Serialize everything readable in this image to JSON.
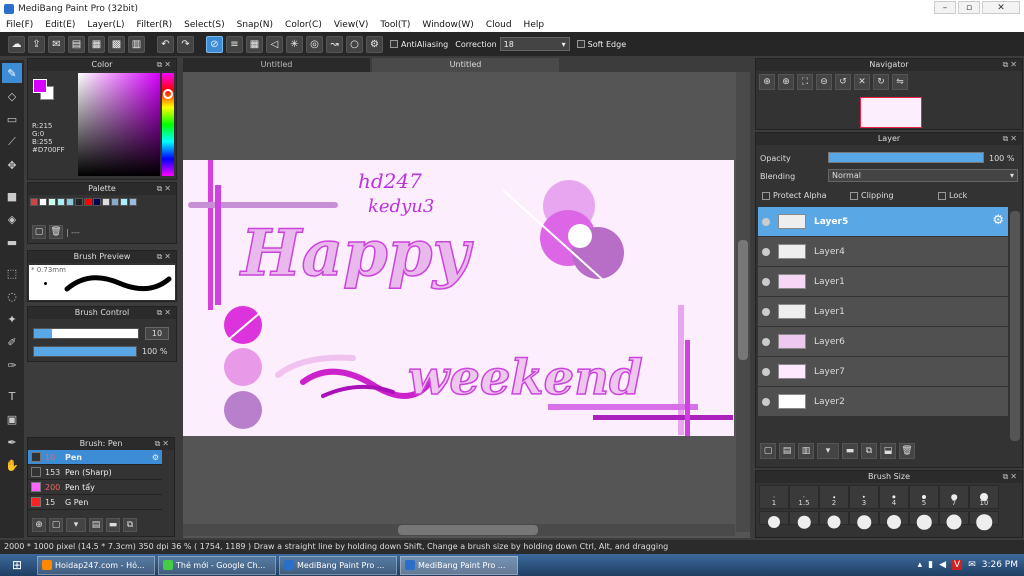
{
  "window": {
    "title": "MediBang Paint Pro (32bit)"
  },
  "menu": [
    "File(F)",
    "Edit(E)",
    "Layer(L)",
    "Filter(R)",
    "Select(S)",
    "Snap(N)",
    "Color(C)",
    "View(V)",
    "Tool(T)",
    "Window(W)",
    "Cloud",
    "Help"
  ],
  "toolbar": {
    "antialiasing_label": "AntiAliasing",
    "correction_label": "Correction",
    "correction_value": "18",
    "softedge_label": "Soft Edge"
  },
  "color": {
    "title": "Color",
    "fg": "#d700ff",
    "bg": "#ffffff",
    "r": "R:215",
    "g": "G:0",
    "b": "B:255",
    "hex": "#D700FF"
  },
  "palette": {
    "title": "Palette",
    "swatches": [
      "#c44",
      "#fff",
      "#cfe",
      "#aee",
      "#8cd",
      "#222",
      "#f00",
      "#005",
      "#ddd",
      "#8ac",
      "#aef",
      "#9bd"
    ],
    "more_label": "| ---"
  },
  "brush_preview": {
    "title": "Brush Preview",
    "size": "* 0.73mm"
  },
  "brush_control": {
    "title": "Brush Control",
    "size_value": "10",
    "size_fill": 0.95,
    "opacity_value": "100 %",
    "opacity_fill": 1.0
  },
  "brush_list": {
    "title": "Brush: Pen",
    "items": [
      {
        "size": "10",
        "name": "Pen",
        "color": "#333333"
      },
      {
        "size": "153",
        "name": "Pen (Sharp)",
        "color": "#333333"
      },
      {
        "size": "200",
        "name": "Pen tẩy",
        "color": "#ff66ff"
      },
      {
        "size": "15",
        "name": "G Pen",
        "color": "#ff2222"
      }
    ]
  },
  "tabs": [
    "Untitled",
    "Untitled"
  ],
  "navigator": {
    "title": "Navigator"
  },
  "layer_panel": {
    "title": "Layer",
    "opacity_label": "Opacity",
    "opacity_value": "100 %",
    "blending_label": "Blending",
    "blending_value": "Normal",
    "protect_alpha": "Protect Alpha",
    "clipping": "Clipping",
    "lock": "Lock",
    "layers": [
      "Layer5",
      "Layer4",
      "Layer1",
      "Layer1",
      "Layer6",
      "Layer7",
      "Layer2"
    ]
  },
  "brush_size": {
    "title": "Brush Size",
    "labels": [
      "1",
      "1.5",
      "2",
      "3",
      "4",
      "5",
      "7",
      "10"
    ]
  },
  "canvas_text": {
    "tag1": "hd247",
    "tag2": "kedyu3",
    "word1": "Happy",
    "word2": "weekend"
  },
  "status": "2000 * 1000 pixel  (14.5 * 7.3cm)  350 dpi  36 %  ( 1754, 1189 )  Draw a straight line by holding down Shift, Change a brush size by holding down Ctrl, Alt, and dragging",
  "taskbar": {
    "items": [
      "Hoidap247.com - Hỏ...",
      "Thẻ mới - Google Ch...",
      "MediBang Paint Pro ...",
      "MediBang Paint Pro ..."
    ],
    "time": "3:26 PM"
  }
}
